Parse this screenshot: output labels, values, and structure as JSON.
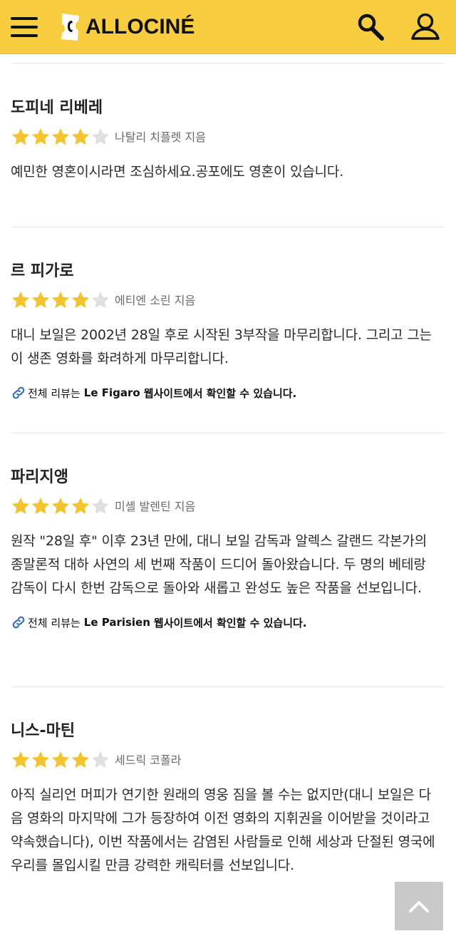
{
  "header": {
    "logo_text": "ALLOCINÉ",
    "background_color": "#f8cd40",
    "menu_icon": "hamburger-icon",
    "search_icon": "search-icon",
    "account_icon": "user-icon"
  },
  "reviews": [
    {
      "outlet": "도피네 리베레",
      "rating": 4,
      "max_rating": 5,
      "author": "나탈리 치플렛 지음",
      "quote": "예민한 영혼이시라면 조심하세요.공포에도 영혼이 있습니다."
    },
    {
      "outlet": "르 피가로",
      "rating": 4,
      "max_rating": 5,
      "author": "에티엔 소린 지음",
      "quote": "대니 보일은 2002년 28일 후로 시작된 3부작을 마무리합니다. 그리고 그는 이 생존 영화를 화려하게 마무리합니다.",
      "source": {
        "prefix": "전체 리뷰는",
        "site": "Le Figaro",
        "suffix": "웹사이트에서 확인할 수 있습니다."
      }
    },
    {
      "outlet": "파리지앵",
      "rating": 4,
      "max_rating": 5,
      "author": "미셸 발렌틴 지음",
      "quote": "원작 \"28일 후\" 이후 23년 만에, 대니 보일 감독과 알렉스 갈랜드 각본가의 종말론적 대하 사연의 세 번째 작품이 드디어 돌아왔습니다. 두 명의 베테랑 감독이 다시 한번 감독으로 돌아와 새롭고 완성도 높은 작품을 선보입니다.",
      "source": {
        "prefix": "전체 리뷰는",
        "site": "Le Parisien",
        "suffix": "웹사이트에서 확인할 수 있습니다."
      }
    },
    {
      "outlet": "니스-마틴",
      "rating": 4,
      "max_rating": 5,
      "author": "세드릭 코폴라",
      "quote": "아직 실리언 머피가 연기한 원래의 영웅 짐을 볼 수는 없지만(대니 보일은 다음 영화의 마지막에 그가 등장하여 이전 영화의 지휘권을 이어받을 것이라고 약속했습니다), 이번 작품에서는 감염된 사람들로 인해 세상과 단절된 영국에 우리를 몰입시킬 만큼 강력한 캐릭터를 선보입니다."
    }
  ],
  "colors": {
    "star_filled": "#f4c430",
    "star_empty": "#e0e0e0",
    "link_icon": "#3b6fb6"
  },
  "back_to_top_icon": "chevron-up-icon"
}
